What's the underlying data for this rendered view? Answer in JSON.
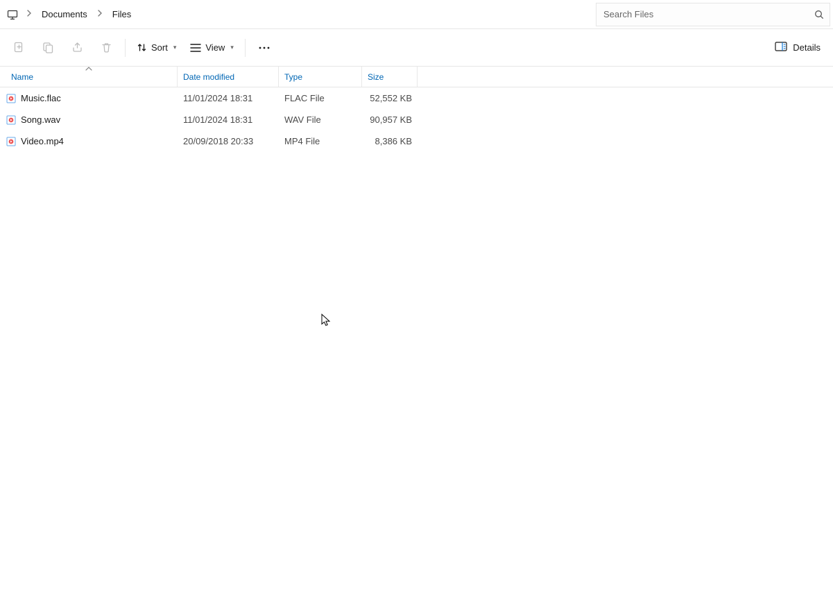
{
  "breadcrumb": {
    "items": [
      "Documents",
      "Files"
    ]
  },
  "search": {
    "placeholder": "Search Files"
  },
  "toolbar": {
    "sort_label": "Sort",
    "view_label": "View",
    "details_label": "Details"
  },
  "columns": {
    "name": "Name",
    "date": "Date modified",
    "type": "Type",
    "size": "Size"
  },
  "files": [
    {
      "name": "Music.flac",
      "date": "11/01/2024 18:31",
      "type": "FLAC File",
      "size": "52,552 KB"
    },
    {
      "name": "Song.wav",
      "date": "11/01/2024 18:31",
      "type": "WAV File",
      "size": "90,957 KB"
    },
    {
      "name": "Video.mp4",
      "date": "20/09/2018 20:33",
      "type": "MP4 File",
      "size": "8,386 KB"
    }
  ]
}
